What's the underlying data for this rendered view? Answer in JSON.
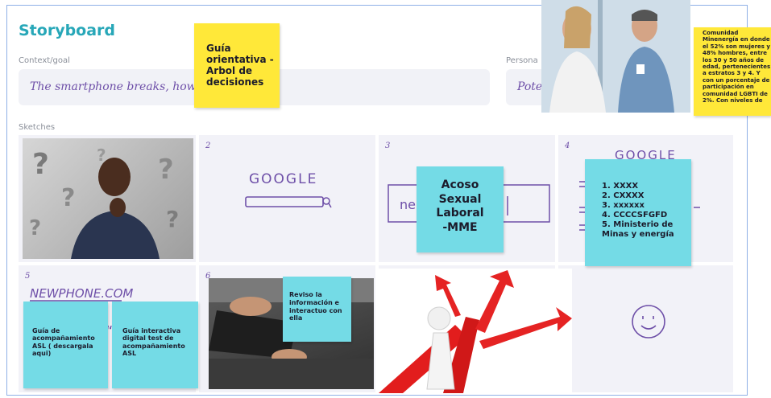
{
  "board": {
    "title": "Storyboard",
    "context_label": "Context/goal",
    "context_value": "The smartphone breaks, how to get",
    "persona_label": "Persona",
    "persona_value": "Poten",
    "sketches_label": "Sketches"
  },
  "cells": [
    {
      "number": "",
      "kind": "photo",
      "description": "thinking-man"
    },
    {
      "number": "2",
      "kind": "sketch",
      "sketch_text": "GOOGLE"
    },
    {
      "number": "3",
      "kind": "sketch",
      "sketch_text": "ne"
    },
    {
      "number": "4",
      "kind": "sketch",
      "sketch_text": "GOOGLE"
    },
    {
      "number": "5",
      "kind": "sketch",
      "sketch_text": "NEWPHONE.COM"
    },
    {
      "number": "6",
      "kind": "photo"
    },
    {
      "number": "",
      "kind": "photo"
    },
    {
      "number": "",
      "kind": "sketch"
    }
  ],
  "stickies": {
    "guia_orientativa": "Guía orientativa - Arbol de decisiones",
    "comunidad": "Comunidad Minenergía en donde el 52% son mujeres y 48% hombres, entre los 30 y 50 años de edad, pertenecientes a estratos 3 y 4. Y con un porcentaje de participación en comunidad LGBTI de 2%. Con niveles de",
    "acoso": [
      "Acoso",
      "Sexual",
      "Laboral",
      "-MME"
    ],
    "lista": [
      "1. XXXX",
      "2. CXXXX",
      "3. xxxxxx",
      "4. CCCCSFGFD",
      "5. Ministerio de Minas y energía"
    ],
    "guia_acompanamiento": "Guía de acompañamiento ASL ( descargala aqui)",
    "guia_interactiva": "Guía interactiva digital test de acompañamiento ASL",
    "reviso": "Reviso la información e interactuo con ella"
  },
  "colors": {
    "title": "#27a7b8",
    "sticky_yellow": "#ffe839",
    "sticky_cyan": "#74dbe6",
    "ink": "#6e4fa8",
    "cell_bg": "#f2f2f8"
  }
}
